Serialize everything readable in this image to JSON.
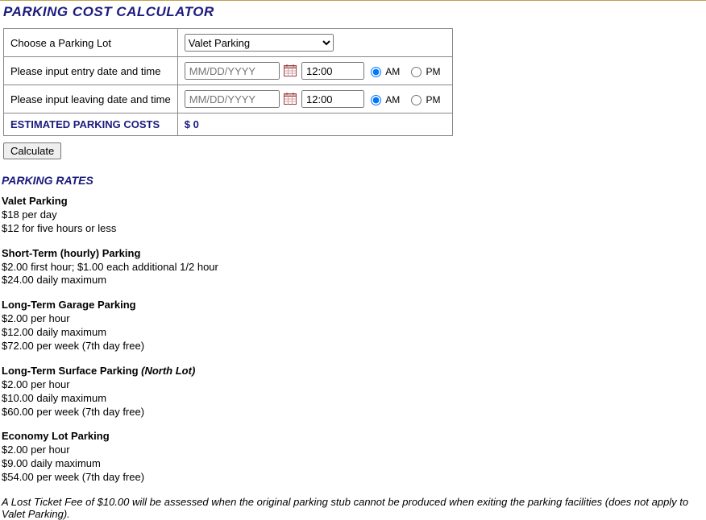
{
  "title": "PARKING COST CALCULATOR",
  "form": {
    "choose_lot_label": "Choose a Parking Lot",
    "lot_selected": "Valet Parking",
    "entry_label": "Please input entry date and time",
    "leaving_label": "Please input leaving date and time",
    "date_placeholder": "MM/DD/YYYY",
    "time_default": "12:00",
    "am_label": "AM",
    "pm_label": "PM",
    "result_label": "ESTIMATED PARKING COSTS",
    "result_value": "$ 0",
    "calculate_label": "Calculate"
  },
  "rates_title": "PARKING RATES",
  "rates": [
    {
      "heading": "Valet Parking",
      "lines": [
        "$18 per day",
        "$12 for five hours or less"
      ]
    },
    {
      "heading": "Short-Term (hourly) Parking",
      "lines": [
        "$2.00 first hour; $1.00 each additional 1/2 hour",
        "$24.00 daily maximum"
      ]
    },
    {
      "heading": "Long-Term Garage Parking",
      "lines": [
        "$2.00 per hour",
        "$12.00 daily maximum",
        "$72.00 per week (7th day free)"
      ]
    },
    {
      "heading": "Long-Term Surface Parking",
      "heading_suffix_italic": "(North Lot)",
      "lines": [
        "$2.00 per hour",
        "$10.00 daily maximum",
        "$60.00 per week (7th day free)"
      ]
    },
    {
      "heading": "Economy Lot Parking",
      "lines": [
        "$2.00 per hour",
        "$9.00 daily maximum",
        "$54.00 per week (7th day free)"
      ]
    }
  ],
  "footnote": "A Lost Ticket Fee of $10.00 will be assessed when the original parking stub cannot be produced when exiting the parking facilities (does not apply to Valet Parking)."
}
